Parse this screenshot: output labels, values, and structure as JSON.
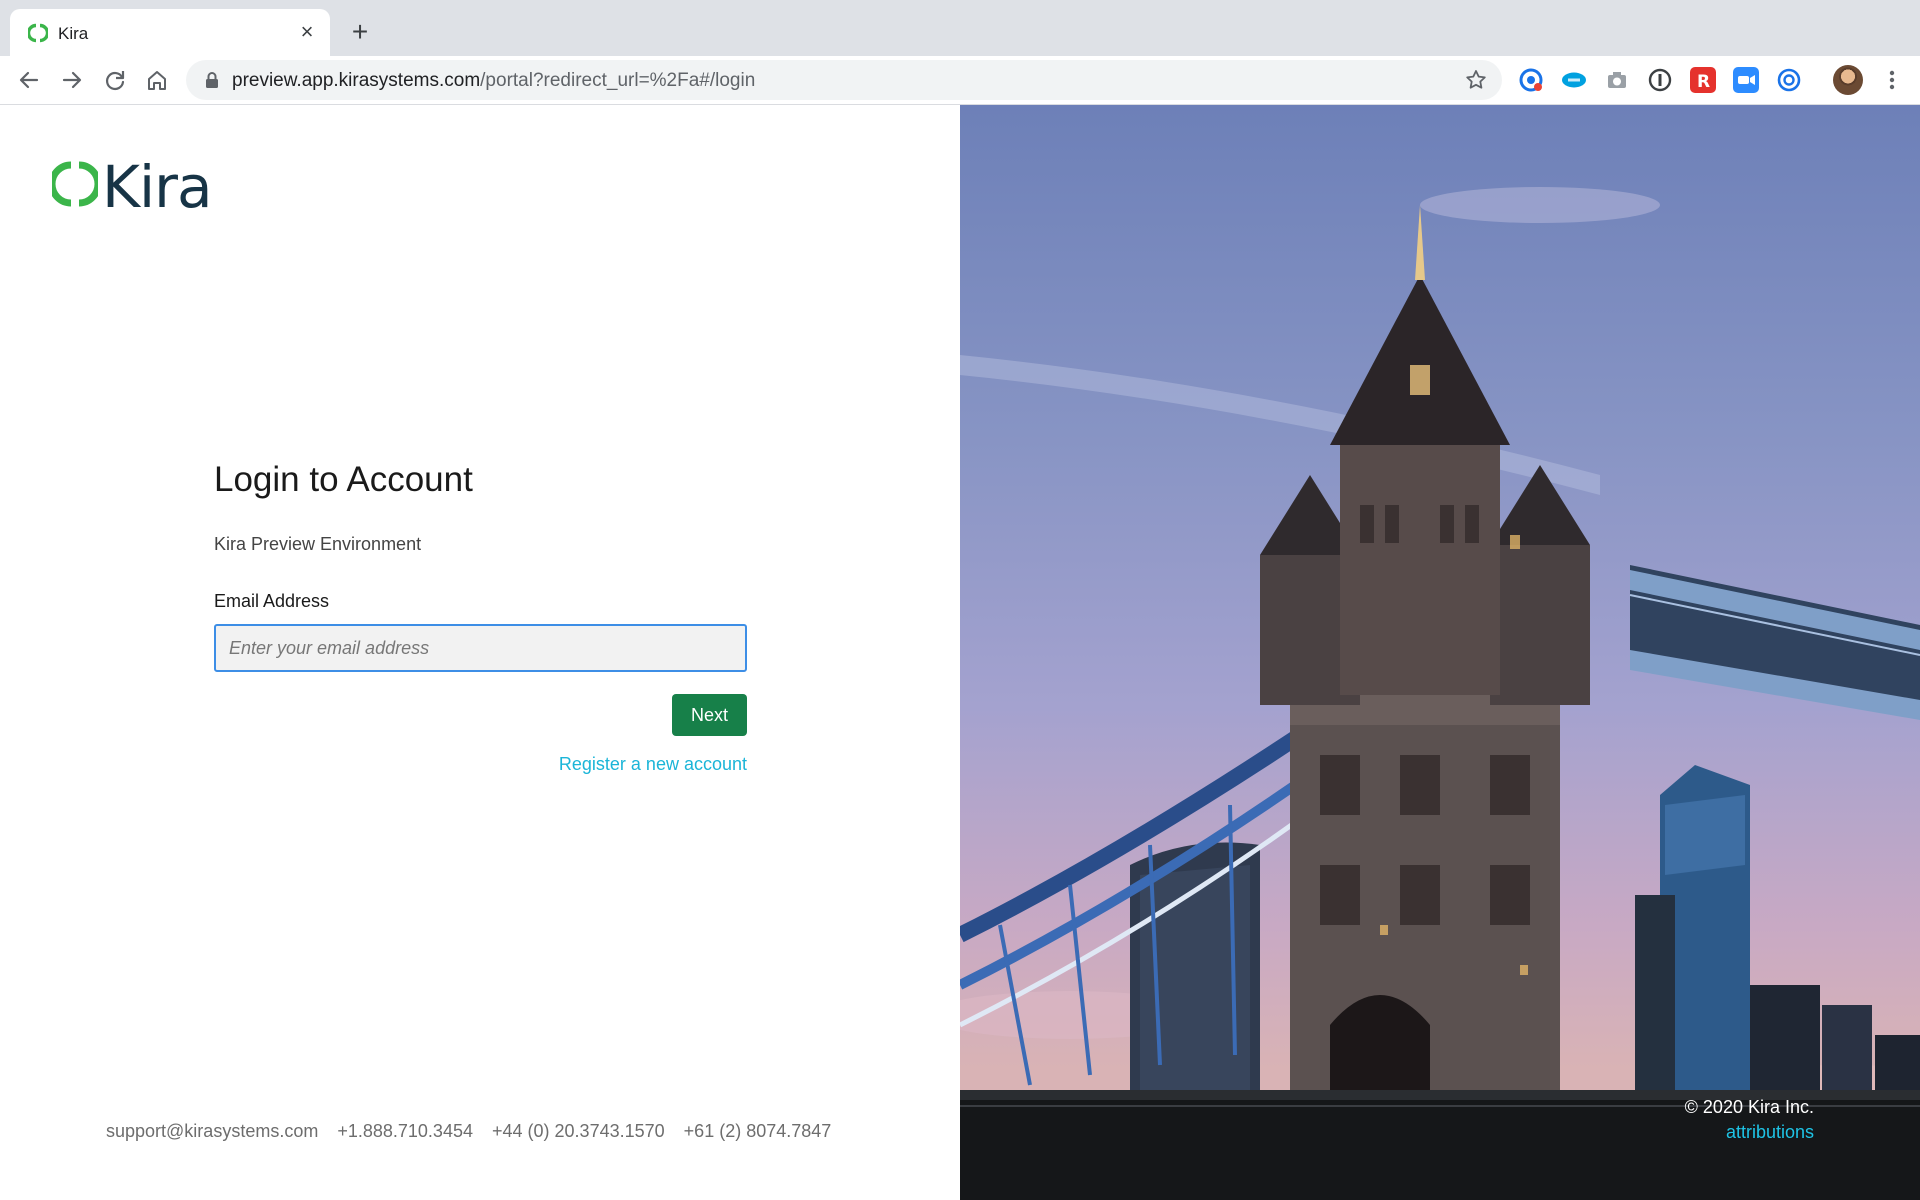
{
  "browser": {
    "tab_title": "Kira",
    "url_host": "preview.app.kirasystems.com",
    "url_path": "/portal?redirect_url=%2Fa#/login"
  },
  "brand": {
    "name": "Kira",
    "green": "#3bb54a",
    "navy": "#173446"
  },
  "login": {
    "title": "Login to Account",
    "subtitle": "Kira Preview Environment",
    "email_label": "Email Address",
    "email_placeholder": "Enter your email address",
    "email_value": "",
    "next_label": "Next",
    "register_label": "Register a new account",
    "button_color": "#178049",
    "link_color": "#1bb5d8"
  },
  "footer": {
    "email": "support@kirasystems.com",
    "phone_na": "+1.888.710.3454",
    "phone_uk": "+44 (0) 20.3743.1570",
    "phone_au": "+61 (2) 8074.7847"
  },
  "photo": {
    "copyright": "© 2020 Kira Inc.",
    "attributions_label": "attributions"
  }
}
